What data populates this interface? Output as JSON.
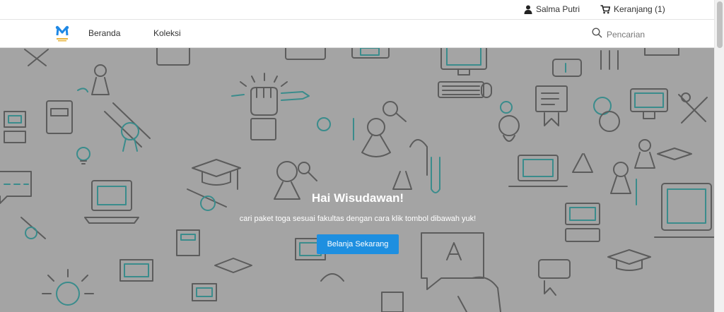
{
  "topbar": {
    "user_name": "Salma Putri",
    "cart_label": "Keranjang (1)"
  },
  "navbar": {
    "items": [
      {
        "label": "Beranda"
      },
      {
        "label": "Koleksi"
      }
    ],
    "search_placeholder": "Pencarian"
  },
  "hero": {
    "title": "Hai Wisudawan!",
    "subtitle": "cari paket toga sesuai fakultas dengan cara klik tombol dibawah yuk!",
    "button_label": "Belanja Sekarang"
  },
  "colors": {
    "hero_background": "#a4a4a4",
    "pattern_gray": "#5c5c5c",
    "pattern_teal": "#3a8c8c",
    "button_blue": "#1e8fe0",
    "logo_blue": "#1e88e5",
    "logo_gold": "#e8b43a"
  },
  "icons": {
    "user": "user-icon",
    "cart": "cart-icon",
    "search": "search-icon"
  }
}
